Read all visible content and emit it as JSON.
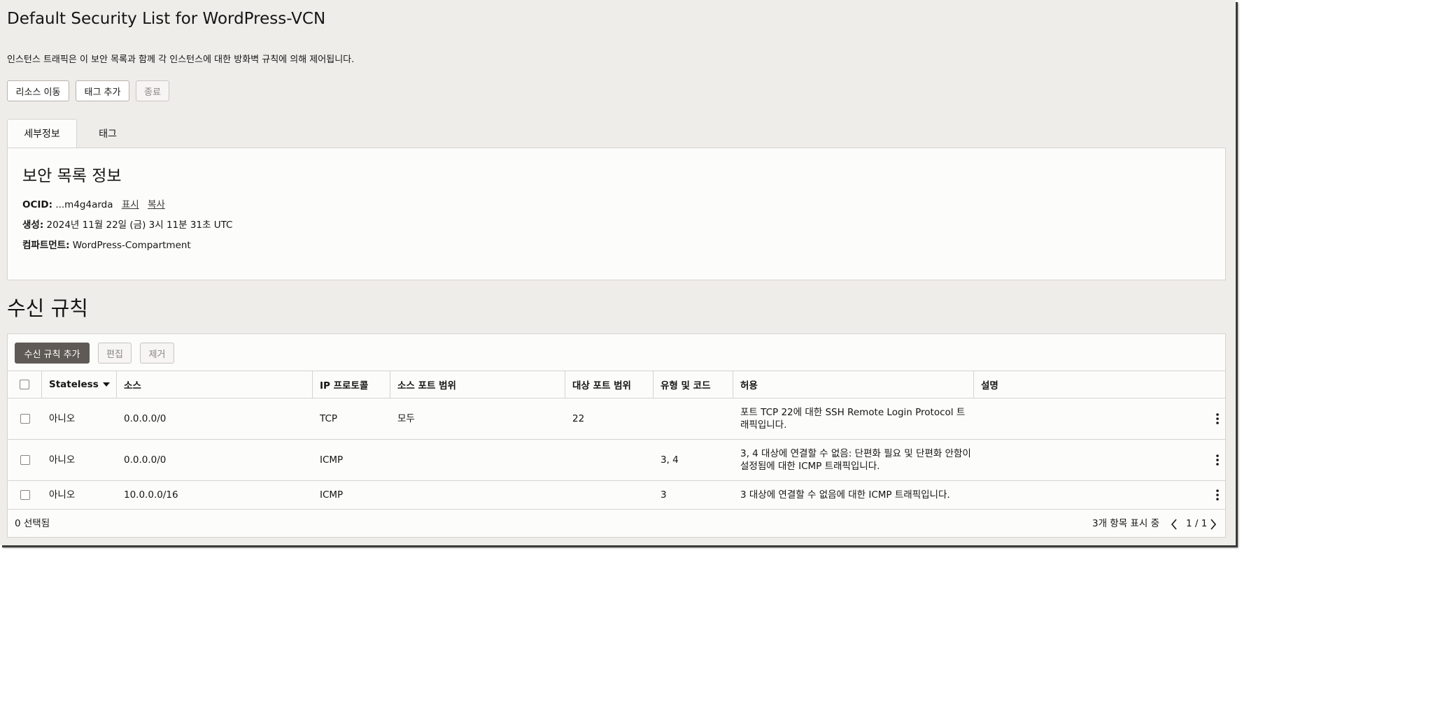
{
  "page": {
    "title": "Default Security List for WordPress-VCN",
    "description": "인스턴스 트래픽은 이 보안 목록과 함께 각 인스턴스에 대한 방화벽 규칙에 의해 제어됩니다."
  },
  "actions": {
    "move_resource": "리소스 이동",
    "add_tags": "태그 추가",
    "terminate": "종료"
  },
  "tabs": [
    {
      "label": "세부정보",
      "active": true
    },
    {
      "label": "태그",
      "active": false
    }
  ],
  "details": {
    "title": "보안 목록 정보",
    "ocid_label": "OCID:",
    "ocid_value": "...m4g4arda",
    "show_link": "표시",
    "copy_link": "복사",
    "created_label": "생성:",
    "created_value": "2024년 11월 22일 (금) 3시 11분 31초 UTC",
    "compartment_label": "컴파트먼트:",
    "compartment_value": "WordPress-Compartment"
  },
  "ingress": {
    "title": "수신 규칙",
    "add_button": "수신 규칙 추가",
    "edit_button": "편집",
    "remove_button": "제거",
    "columns": [
      "Stateless",
      "소스",
      "IP 프로토콜",
      "소스 포트 범위",
      "대상 포트 범위",
      "유형 및 코드",
      "허용",
      "설명"
    ],
    "rows": [
      {
        "stateless": "아니오",
        "source": "0.0.0.0/0",
        "protocol": "TCP",
        "src_port": "모두",
        "dst_port": "22",
        "type_code": "",
        "allows": "포트 TCP 22에 대한 SSH Remote Login Protocol 트래픽입니다.",
        "description": ""
      },
      {
        "stateless": "아니오",
        "source": "0.0.0.0/0",
        "protocol": "ICMP",
        "src_port": "",
        "dst_port": "",
        "type_code": "3, 4",
        "allows": "3, 4 대상에 연결할 수 없음: 단편화 필요 및 단편화 안함이 설정됨에 대한 ICMP 트래픽입니다.",
        "description": ""
      },
      {
        "stateless": "아니오",
        "source": "10.0.0.0/16",
        "protocol": "ICMP",
        "src_port": "",
        "dst_port": "",
        "type_code": "3",
        "allows": "3 대상에 연결할 수 없음에 대한 ICMP 트래픽입니다.",
        "description": ""
      }
    ],
    "selected_text": "0 선택됨",
    "showing_text": "3개 항목 표시 중",
    "page_text": "1 / 1"
  }
}
